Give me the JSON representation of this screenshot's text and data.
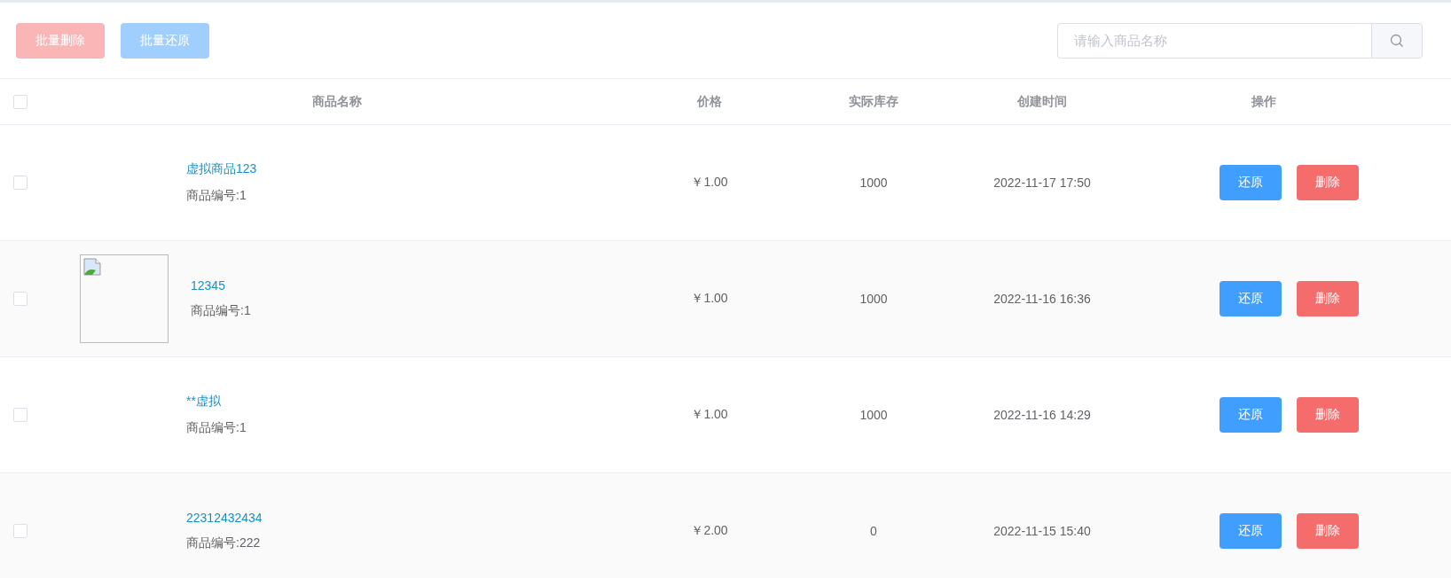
{
  "toolbar": {
    "buttons": [
      {
        "label": "批量删除",
        "kind": "danger",
        "disabled": true
      },
      {
        "label": "批量还原",
        "kind": "primary",
        "disabled": true
      }
    ],
    "search": {
      "placeholder": "请输入商品名称"
    }
  },
  "table": {
    "select_all": {
      "checked": false
    },
    "columns": [
      "商品名称",
      "价格",
      "实际库存",
      "创建时间",
      "操作"
    ],
    "rows": [
      {
        "checked": false,
        "has_image": false,
        "name": "虚拟商品123",
        "code": "商品编号:1",
        "price": "￥1.00",
        "stock": "1000",
        "created": "2022-11-17 17:50",
        "actions": [
          "还原",
          "删除"
        ]
      },
      {
        "checked": false,
        "has_image": true,
        "name": "12345",
        "code": "商品编号:1",
        "price": "￥1.00",
        "stock": "1000",
        "created": "2022-11-16 16:36",
        "actions": [
          "还原",
          "删除"
        ]
      },
      {
        "checked": false,
        "has_image": false,
        "name": "**虚拟",
        "code": "商品编号:1",
        "price": "￥1.00",
        "stock": "1000",
        "created": "2022-11-16 14:29",
        "actions": [
          "还原",
          "删除"
        ]
      },
      {
        "checked": false,
        "has_image": false,
        "name": "22312432434",
        "code": "商品编号:222",
        "price": "￥2.00",
        "stock": "0",
        "created": "2022-11-15 15:40",
        "actions": [
          "还原",
          "删除"
        ]
      }
    ]
  }
}
